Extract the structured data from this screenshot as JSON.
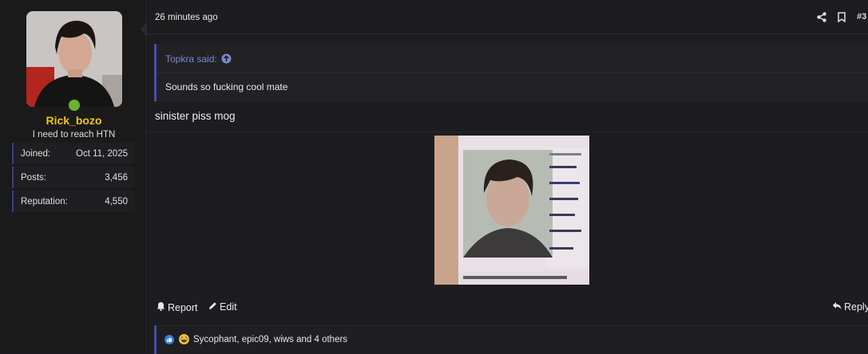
{
  "user": {
    "username": "Rick_bozo",
    "title": "I need to reach HTN",
    "stats": [
      {
        "label": "Joined:",
        "value": "Oct 11, 2025"
      },
      {
        "label": "Posts:",
        "value": "3,456"
      },
      {
        "label": "Reputation:",
        "value": "4,550"
      }
    ],
    "status_color": "#6ab42f",
    "username_color": "#f0c419"
  },
  "post": {
    "time": "26 minutes ago",
    "number": "#3",
    "quote": {
      "author": "Topkra said:",
      "text": "Sounds so fucking cool mate"
    },
    "body": "sinister piss mog"
  },
  "actions": {
    "report": "Report",
    "edit": "Edit",
    "reply": "Reply"
  },
  "reactions": {
    "icons": [
      "like-icon",
      "laugh-icon"
    ],
    "text": "Sycophant, epic09, wiws and 4 others"
  },
  "accent": "#4a4ea6"
}
